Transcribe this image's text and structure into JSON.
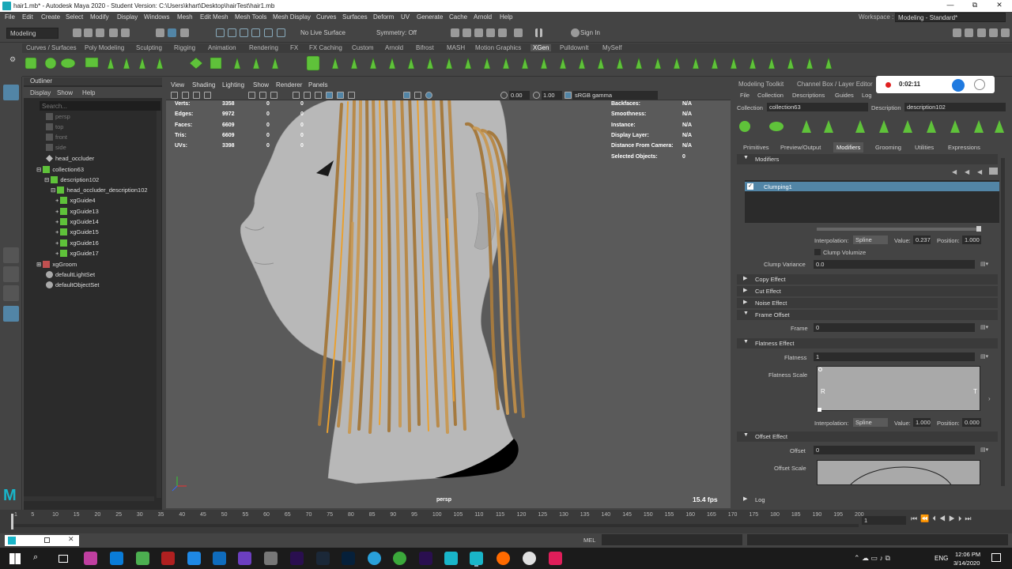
{
  "title": "hair1.mb* - Autodesk Maya 2020 - Student Version: C:\\Users\\khart\\Desktop\\hairTest\\hair1.mb",
  "window_controls": {
    "minimize": "—",
    "maximize": "⧉",
    "close": "✕"
  },
  "menus": [
    "File",
    "Edit",
    "Create",
    "Select",
    "Modify",
    "Display",
    "Windows",
    "Mesh",
    "Edit Mesh",
    "Mesh Tools",
    "Mesh Display",
    "Curves",
    "Surfaces",
    "Deform",
    "UV",
    "Generate",
    "Cache",
    "Arnold",
    "Help"
  ],
  "workspace": {
    "label": "Workspace :",
    "value": "Modeling - Standard*"
  },
  "statusline": {
    "mode": "Modeling",
    "live_surface": "No Live Surface",
    "symmetry": "Symmetry: Off",
    "sign_in": "Sign In"
  },
  "shelf_tabs": [
    "Curves / Surfaces",
    "Poly Modeling",
    "Sculpting",
    "Rigging",
    "Animation",
    "Rendering",
    "FX",
    "FX Caching",
    "Custom",
    "Arnold",
    "Bifrost",
    "MASH",
    "Motion Graphics",
    "XGen",
    "Pulldownlt",
    "MySelf"
  ],
  "shelf_active": "XGen",
  "outliner": {
    "title": "Outliner",
    "menu": [
      "Display",
      "Show",
      "Help"
    ],
    "search_placeholder": "Search...",
    "items": [
      {
        "label": "persp",
        "dim": true
      },
      {
        "label": "top",
        "dim": true
      },
      {
        "label": "front",
        "dim": true
      },
      {
        "label": "side",
        "dim": true
      },
      {
        "label": "head_occluder",
        "dim": false
      },
      {
        "label": "collection63",
        "dim": false
      },
      {
        "label": "description102",
        "dim": false
      },
      {
        "label": "head_occluder_description102",
        "dim": false
      },
      {
        "label": "xgGuide4",
        "dim": false
      },
      {
        "label": "xgGuide13",
        "dim": false
      },
      {
        "label": "xgGuide14",
        "dim": false
      },
      {
        "label": "xgGuide15",
        "dim": false
      },
      {
        "label": "xgGuide16",
        "dim": false
      },
      {
        "label": "xgGuide17",
        "dim": false
      },
      {
        "label": "xgGroom",
        "dim": false
      },
      {
        "label": "defaultLightSet",
        "dim": false
      },
      {
        "label": "defaultObjectSet",
        "dim": false
      }
    ]
  },
  "viewport": {
    "menu": [
      "View",
      "Shading",
      "Lighting",
      "Show",
      "Renderer",
      "Panels"
    ],
    "exposure": "0.00",
    "gamma": "1.00",
    "color_space": "sRGB gamma",
    "stats": [
      {
        "label": "Verts:",
        "v1": "3358",
        "v2": "0",
        "v3": "0"
      },
      {
        "label": "Edges:",
        "v1": "9972",
        "v2": "0",
        "v3": "0"
      },
      {
        "label": "Faces:",
        "v1": "6609",
        "v2": "0",
        "v3": "0"
      },
      {
        "label": "Tris:",
        "v1": "6609",
        "v2": "0",
        "v3": "0"
      },
      {
        "label": "UVs:",
        "v1": "3398",
        "v2": "0",
        "v3": "0"
      }
    ],
    "stats_right": [
      {
        "label": "Backfaces:",
        "value": "N/A"
      },
      {
        "label": "Smoothness:",
        "value": "N/A"
      },
      {
        "label": "Instance:",
        "value": "N/A"
      },
      {
        "label": "Display Layer:",
        "value": "N/A"
      },
      {
        "label": "Distance From Camera:",
        "value": "N/A"
      },
      {
        "label": "Selected Objects:",
        "value": "0"
      }
    ],
    "camera": "persp",
    "fps": "15.4 fps"
  },
  "recorder": {
    "time": "0:02:11"
  },
  "right_panel": {
    "tabs": [
      "Modeling Toolkit",
      "Channel Box / Layer Editor"
    ],
    "menu": [
      "File",
      "Collection",
      "Descriptions",
      "Guides",
      "Log"
    ],
    "collection_label": "Collection",
    "collection_value": "collection63",
    "description_label": "Description",
    "description_value": "description102",
    "subtabs": [
      "Primitives",
      "Preview/Output",
      "Modifiers",
      "Grooming",
      "Utilities",
      "Expressions"
    ],
    "active_subtab": "Modifiers",
    "modifiers_header": "Modifiers",
    "modifier_item": "Clumping1",
    "interp1": {
      "label": "Interpolation:",
      "value": "Spline",
      "value_label": "Value:",
      "value_num": "0.237",
      "pos_label": "Position:",
      "pos_num": "1.000"
    },
    "clump_volumize": "Clump Volumize",
    "clump_variance": {
      "label": "Clump Variance",
      "value": "0.0"
    },
    "sections": [
      "Copy Effect",
      "Cut Effect",
      "Noise Effect",
      "Frame Offset",
      "Flatness Effect",
      "Offset Effect"
    ],
    "frame": {
      "label": "Frame",
      "value": "0"
    },
    "flatness": {
      "label": "Flatness",
      "value": "1"
    },
    "flatness_scale": {
      "label": "Flatness Scale",
      "left": "R",
      "right": "T"
    },
    "interp2": {
      "label": "Interpolation:",
      "value": "Spline",
      "value_label": "Value:",
      "value_num": "1.000",
      "pos_label": "Position:",
      "pos_num": "0.000"
    },
    "offset": {
      "label": "Offset",
      "value": "0"
    },
    "offset_scale": {
      "label": "Offset Scale"
    },
    "log": "Log"
  },
  "timeline": {
    "ticks": [
      "1",
      "5",
      "10",
      "15",
      "20",
      "25",
      "30",
      "35",
      "40",
      "45",
      "50",
      "55",
      "60",
      "65",
      "70",
      "75",
      "80",
      "85",
      "90",
      "95",
      "100",
      "105",
      "110",
      "115",
      "120",
      "125",
      "130",
      "135",
      "140",
      "145",
      "150",
      "155",
      "160",
      "165",
      "170",
      "175",
      "180",
      "185",
      "190",
      "195",
      "200"
    ],
    "current_frame": "1"
  },
  "cmdline": {
    "label": "MEL"
  },
  "taskbar": {
    "time": "12:06 PM",
    "date": "3/14/2020",
    "lang": "ENG"
  },
  "colors": {
    "accent": "#5285a6",
    "hair": "#b88a4a",
    "hair_highlight": "#e9a030",
    "record": "#e02020"
  }
}
